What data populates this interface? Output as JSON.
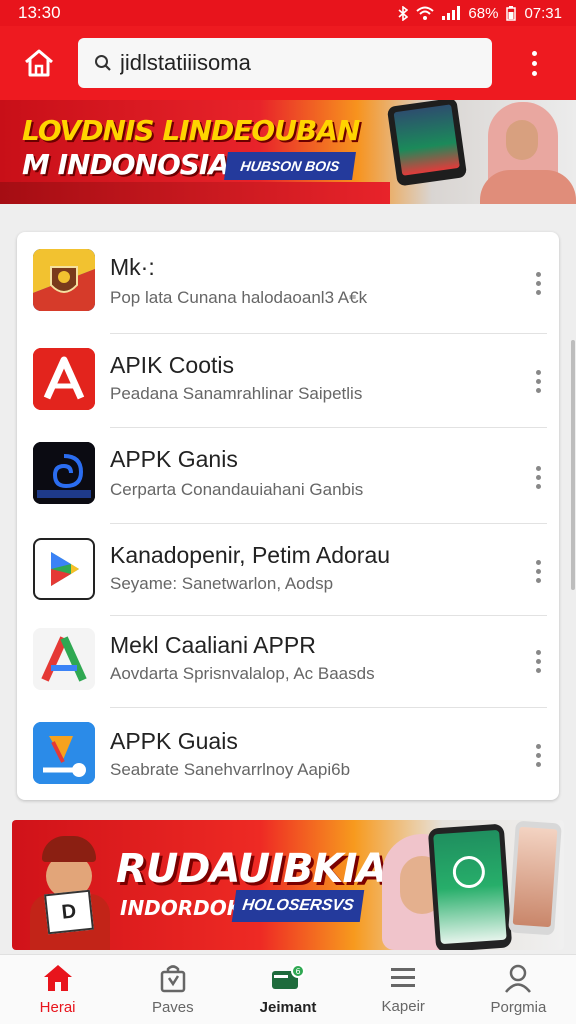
{
  "status_bar": {
    "time": "13:30",
    "battery": "68%",
    "clock_right": "07:31"
  },
  "search": {
    "value": "jidlstatiiisoma"
  },
  "banner_top": {
    "line1": "LOVDNIS LINDEOUBAN",
    "line2": "M INDONOSIA!",
    "badge": "HUBSON BOIS"
  },
  "apps": [
    {
      "title": "Mk·:",
      "subtitle": "Pop lata Cunana halodaoanl3 A€k",
      "icon": "garuda-shield-icon"
    },
    {
      "title": "APIK Cootis",
      "subtitle": "Peadana Sanamrahlinar Saipetlis",
      "icon": "red-a-icon"
    },
    {
      "title": "APPK Ganis",
      "subtitle": "Cerparta Conandauiahani Ganbis",
      "icon": "spiral-icon"
    },
    {
      "title": "Kanadopenir, Petim Adorau",
      "subtitle": "Seyame: Sanetwarlon, Aodsp",
      "icon": "play-store-icon"
    },
    {
      "title": "Mekl Caaliani APPR",
      "subtitle": "Aovdarta Sprisnvalalop, Ac Baasds",
      "icon": "tri-color-a-icon"
    },
    {
      "title": "APPK Guais",
      "subtitle": "Seabrate Sanehvarrlnoy Aapi6b",
      "icon": "blue-download-icon"
    }
  ],
  "banner_bottom": {
    "title": "RUDAUIBKIA I",
    "subtitle": "INDORDOK",
    "badge": "HOLOSERSVS",
    "sign": "D"
  },
  "nav": [
    {
      "label": "Herai",
      "icon": "home-icon",
      "active": true
    },
    {
      "label": "Paves",
      "icon": "store-bag-icon",
      "active": false
    },
    {
      "label": "Jeimant",
      "icon": "payment-card-icon",
      "active": false
    },
    {
      "label": "Kapeir",
      "icon": "menu-list-icon",
      "active": false
    },
    {
      "label": "Porgmia",
      "icon": "profile-icon",
      "active": false
    }
  ],
  "colors": {
    "brand_red": "#e8141c",
    "badge_blue": "#243a9c",
    "accent_yellow": "#ffd400"
  }
}
